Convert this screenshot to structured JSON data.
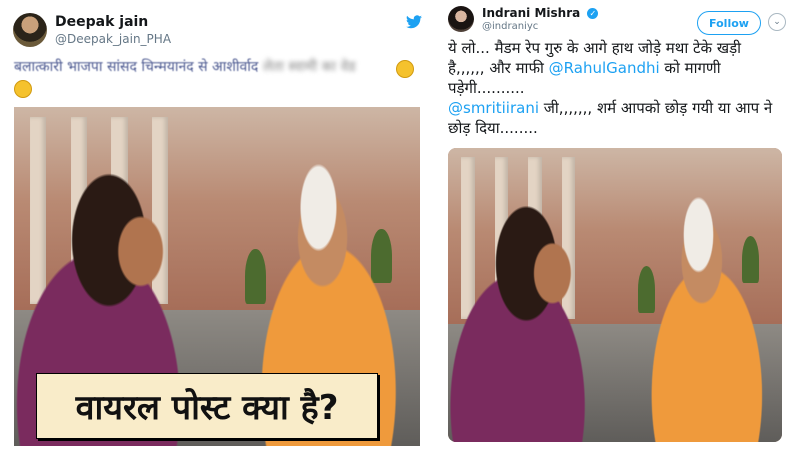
{
  "left_tweet": {
    "user_name": "Deepak jain",
    "user_handle": "@Deepak_jain_PHA",
    "text_visible": "बलात्कारी भाजपा सांसद चिन्मयानंद से आशीर्वाद",
    "text_blurred": "लेता स्वामी का वेड",
    "icons": [
      "twitter-bird-icon",
      "emoji-icon",
      "sunglasses-emoji-icon"
    ]
  },
  "overlay_caption": "वायरल पोस्ट क्या है?",
  "right_tweet": {
    "user_name": "Indrani Mishra",
    "user_handle": "@indraniyc",
    "follow_label": "Follow",
    "caret": "⌄",
    "line1": "ये लो... मैडम रेप गुरु के आगे हाथ जोड़े मथा टेके खड़ी है,,,,,, और माफी ",
    "mention1": "@RahulGandhi",
    "line1_end": " को मागणी पड़ेगी..........",
    "mention2": "@smritiirani",
    "line2": " जी,,,,,,, शर्म आपको छोड़ गयी या आप ने छोड़ दिया........"
  },
  "colors": {
    "accent": "#1da1f2",
    "caption_bg": "#f9ecc9",
    "blurred_text": "#4d5a91"
  }
}
